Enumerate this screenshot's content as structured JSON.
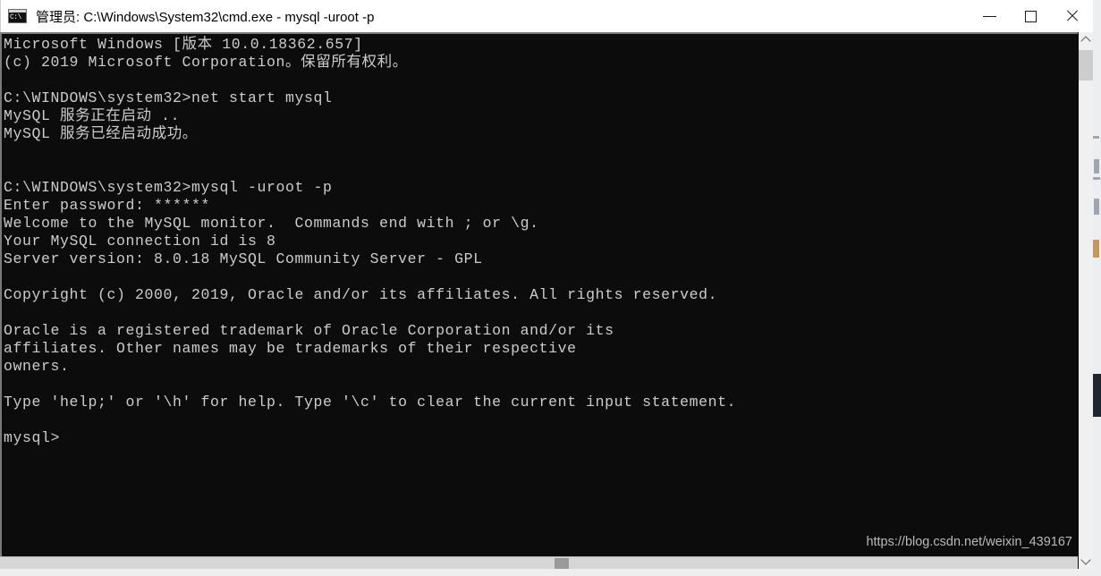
{
  "window": {
    "title": "管理员: C:\\Windows\\System32\\cmd.exe - mysql  -uroot -p",
    "icon_label": "C:\\",
    "controls": {
      "minimize_label": "最小化",
      "maximize_label": "最大化",
      "close_label": "关闭"
    }
  },
  "terminal": {
    "background_color": "#0c0c0c",
    "foreground_color": "#cccccc",
    "lines": [
      "Microsoft Windows [版本 10.0.18362.657]",
      "(c) 2019 Microsoft Corporation。保留所有权利。",
      "",
      "C:\\WINDOWS\\system32>net start mysql",
      "MySQL 服务正在启动 ..",
      "MySQL 服务已经启动成功。",
      "",
      "",
      "C:\\WINDOWS\\system32>mysql -uroot -p",
      "Enter password: ******",
      "Welcome to the MySQL monitor.  Commands end with ; or \\g.",
      "Your MySQL connection id is 8",
      "Server version: 8.0.18 MySQL Community Server - GPL",
      "",
      "Copyright (c) 2000, 2019, Oracle and/or its affiliates. All rights reserved.",
      "",
      "Oracle is a registered trademark of Oracle Corporation and/or its",
      "affiliates. Other names may be trademarks of their respective",
      "owners.",
      "",
      "Type 'help;' or '\\h' for help. Type '\\c' to clear the current input statement.",
      "",
      "mysql>"
    ]
  },
  "watermark": {
    "text": "https://blog.csdn.net/weixin_439167"
  },
  "scrollbars": {
    "vertical": {
      "up_arrow": "▲",
      "down_arrow": "▼"
    },
    "horizontal": {}
  }
}
